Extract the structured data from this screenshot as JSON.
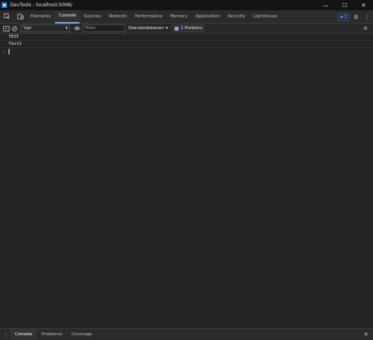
{
  "window": {
    "title": "DevTools - localhost:5006/",
    "minimize_glyph": "—",
    "maximize_glyph": "☐",
    "close_glyph": "✕"
  },
  "tabs": [
    {
      "label": "Elements",
      "active": false
    },
    {
      "label": "Console",
      "active": true
    },
    {
      "label": "Sources",
      "active": false
    },
    {
      "label": "Network",
      "active": false
    },
    {
      "label": "Performance",
      "active": false
    },
    {
      "label": "Memory",
      "active": false
    },
    {
      "label": "Application",
      "active": false
    },
    {
      "label": "Security",
      "active": false
    },
    {
      "label": "Lighthouse",
      "active": false
    }
  ],
  "issues_count": "2",
  "toolbar": {
    "context": "'top'",
    "filter_placeholder": "Filter",
    "levels": "Standardebenen",
    "problems": "1 Problem"
  },
  "console_lines": [
    "TEST",
    "Test2"
  ],
  "prompt_symbol": "›",
  "drawer_tabs": [
    {
      "label": "Console",
      "active": true
    },
    {
      "label": "Probleme",
      "active": false
    },
    {
      "label": "Coverage",
      "active": false
    }
  ],
  "icons": {
    "app": "devtools-app-icon",
    "inspect": "inspect-element-icon",
    "device": "device-toolbar-icon",
    "sidebar": "sidebar-toggle-icon",
    "clear": "clear-console-icon",
    "eye": "live-expression-eye-icon",
    "settings": "gear-icon",
    "more": "kebab-menu-icon"
  },
  "colors": {
    "background": "#242424",
    "accent": "#7cacf8",
    "titlebar": "#141414"
  }
}
